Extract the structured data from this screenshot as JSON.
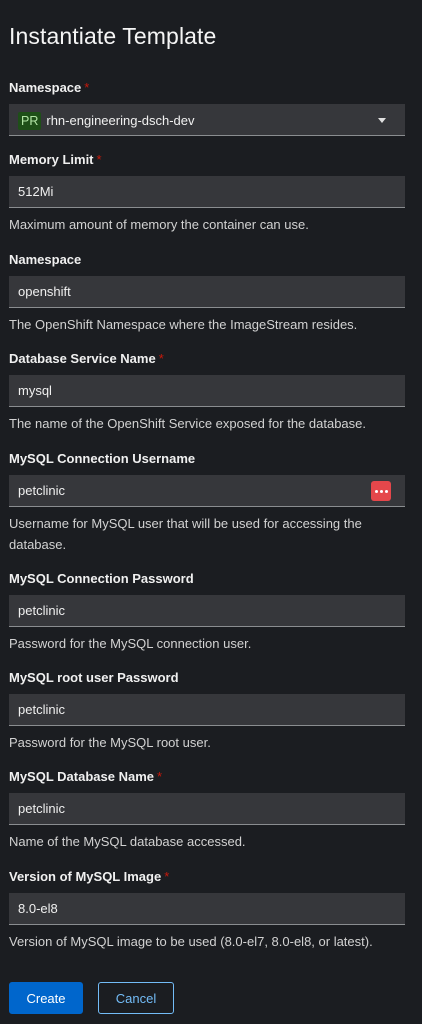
{
  "page": {
    "title": "Instantiate Template"
  },
  "namespace_select": {
    "label": "Namespace",
    "required_marker": "*",
    "badge": "PR",
    "value": "rhn-engineering-dsch-dev"
  },
  "fields": [
    {
      "label": "Memory Limit",
      "required": "*",
      "value": "512Mi",
      "help": "Maximum amount of memory the container can use."
    },
    {
      "label": "Namespace",
      "required": "",
      "value": "openshift",
      "help": "The OpenShift Namespace where the ImageStream resides."
    },
    {
      "label": "Database Service Name",
      "required": "*",
      "value": "mysql",
      "help": "The name of the OpenShift Service exposed for the database."
    },
    {
      "label": "MySQL Connection Username",
      "required": "",
      "value": "petclinic",
      "help": "Username for MySQL user that will be used for accessing the database."
    },
    {
      "label": "MySQL Connection Password",
      "required": "",
      "value": "petclinic",
      "help": "Password for the MySQL connection user."
    },
    {
      "label": "MySQL root user Password",
      "required": "",
      "value": "petclinic",
      "help": "Password for the MySQL root user."
    },
    {
      "label": "MySQL Database Name",
      "required": "*",
      "value": "petclinic",
      "help": "Name of the MySQL database accessed."
    },
    {
      "label": "Version of MySQL Image",
      "required": "*",
      "value": "8.0-el8",
      "help": "Version of MySQL image to be used (8.0-el7, 8.0-el8, or latest)."
    }
  ],
  "icons": {
    "dropdown": "caret-down-icon",
    "password_manager": "kebab-dots-icon"
  },
  "actions": {
    "create": "Create",
    "cancel": "Cancel"
  },
  "colors": {
    "primary": "#0066cc",
    "link": "#73bcf7",
    "required": "#c9190b",
    "badge_bg": "#1e4f18",
    "kebab_bg": "#e5474b"
  }
}
